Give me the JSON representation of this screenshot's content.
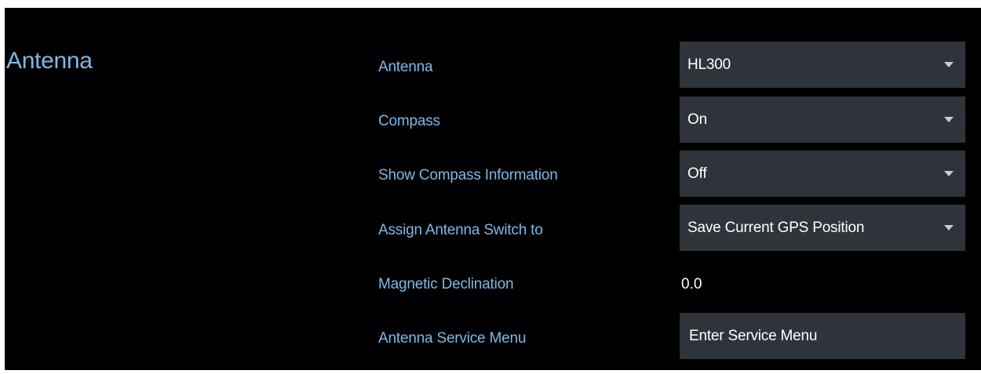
{
  "section": {
    "title": "Antenna"
  },
  "rows": [
    {
      "label": "Antenna",
      "value": "HL300",
      "kind": "dropdown"
    },
    {
      "label": "Compass",
      "value": "On",
      "kind": "dropdown"
    },
    {
      "label": "Show Compass Information",
      "value": "Off",
      "kind": "dropdown"
    },
    {
      "label": "Assign Antenna Switch to",
      "value": "Save Current GPS Position",
      "kind": "dropdown"
    },
    {
      "label": "Magnetic Declination",
      "value": "0.0",
      "kind": "text"
    },
    {
      "label": "Antenna Service Menu",
      "value": "Enter Service Menu",
      "kind": "button"
    }
  ],
  "icons": {
    "dropdown": "caret-down-icon"
  },
  "colors": {
    "background": "#000000",
    "label": "#7fb8e6",
    "control_bg": "#2f343a",
    "value_text": "#ffffff"
  }
}
